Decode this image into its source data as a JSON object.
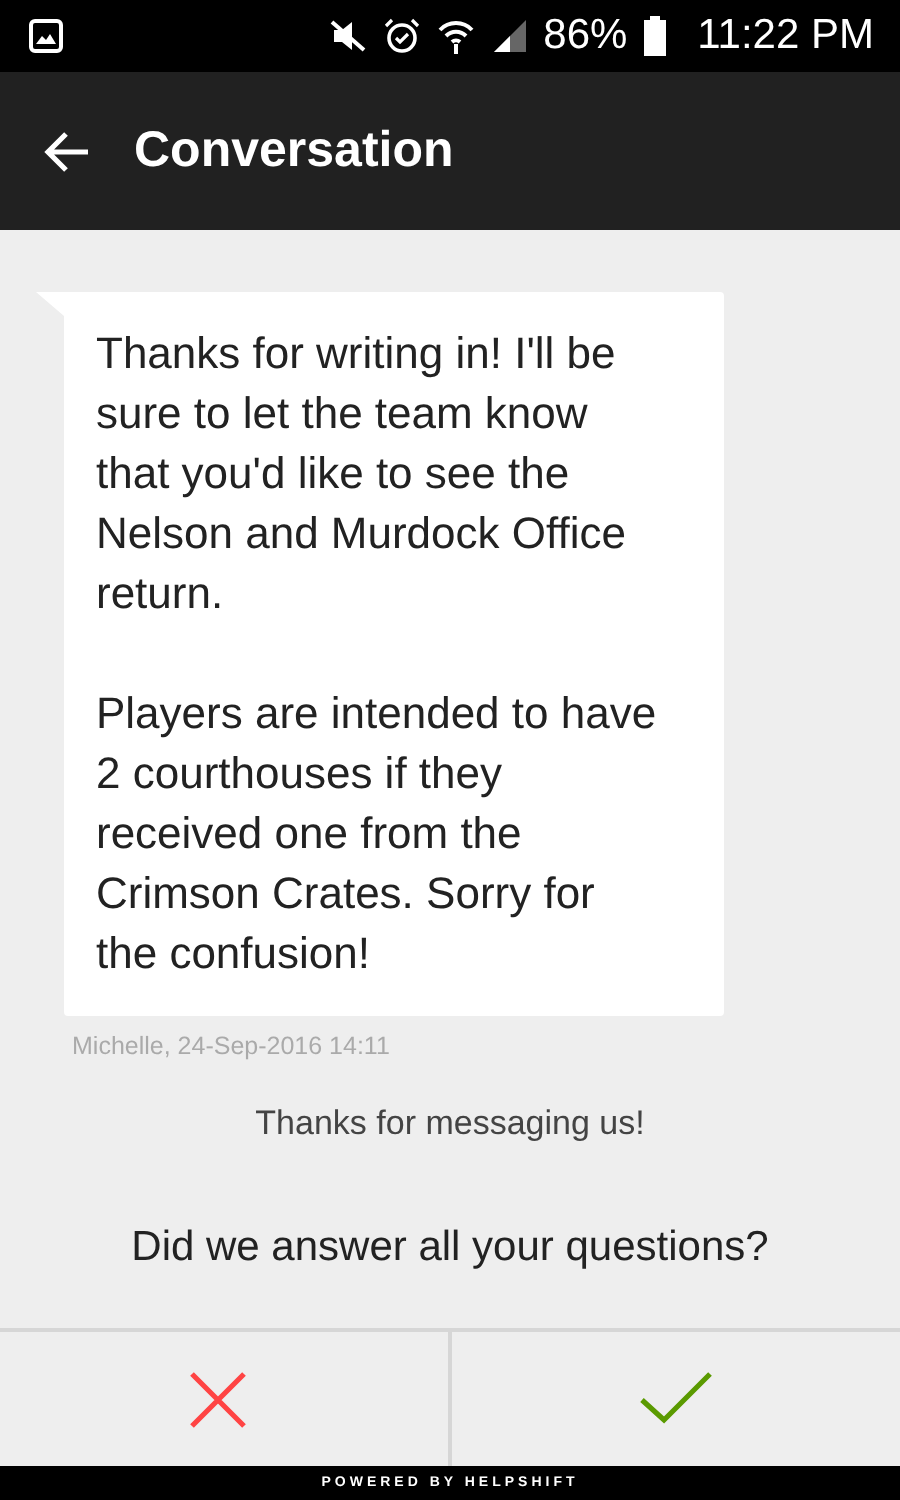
{
  "status_bar": {
    "battery": "86%",
    "time": "11:22 PM"
  },
  "app_bar": {
    "title": "Conversation"
  },
  "messages": [
    {
      "paragraphs": [
        "Thanks for writing in! I'll be sure to let the team know that you'd like to see the Nelson and Murdock Office return.",
        "Players are intended to have 2 courthouses if they received one from the Crimson Crates. Sorry for the confusion!"
      ],
      "meta": "Michelle, 24-Sep-2016 14:11"
    }
  ],
  "notice": "Thanks for messaging us!",
  "question": "Did we answer all your questions?",
  "answers": [
    {
      "kind": "no"
    },
    {
      "kind": "yes"
    }
  ],
  "footer": "POWERED BY HELPSHIFT"
}
